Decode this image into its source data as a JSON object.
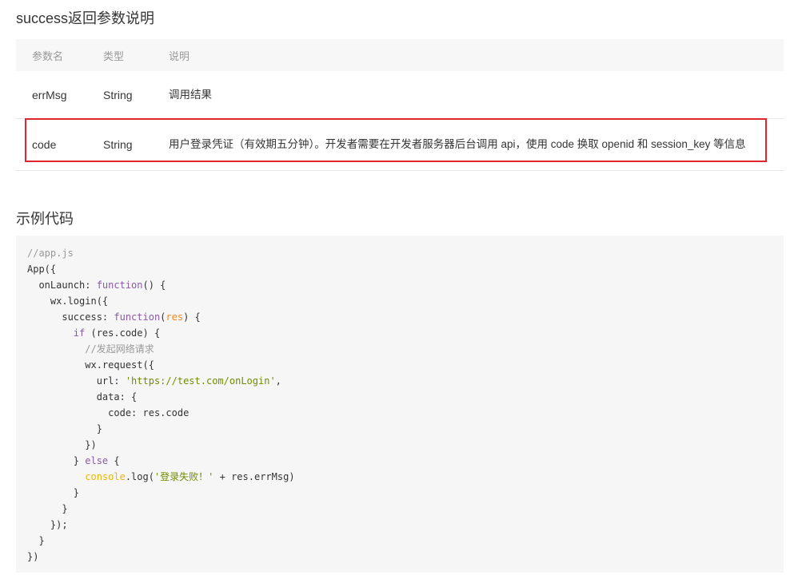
{
  "section_params": {
    "title": "success返回参数说明",
    "headers": [
      "参数名",
      "类型",
      "说明"
    ],
    "rows": [
      {
        "name": "errMsg",
        "type": "String",
        "desc": "调用结果"
      },
      {
        "name": "code",
        "type": "String",
        "desc": "用户登录凭证（有效期五分钟）。开发者需要在开发者服务器后台调用 api，使用 code 换取 openid 和 session_key 等信息"
      }
    ],
    "highlight_color": "#e0262b"
  },
  "section_example": {
    "title": "示例代码",
    "code_lines": [
      [
        {
          "t": "//app.js",
          "c": "comment"
        }
      ],
      [
        {
          "t": "App({"
        }
      ],
      [
        {
          "t": "  onLaunch: "
        },
        {
          "t": "function",
          "c": "key"
        },
        {
          "t": "() {"
        }
      ],
      [
        {
          "t": "    wx.login({"
        }
      ],
      [
        {
          "t": "      success: "
        },
        {
          "t": "function",
          "c": "key"
        },
        {
          "t": "("
        },
        {
          "t": "res",
          "c": "param"
        },
        {
          "t": ") {"
        }
      ],
      [
        {
          "t": "        "
        },
        {
          "t": "if",
          "c": "key"
        },
        {
          "t": " (res.code) {"
        }
      ],
      [
        {
          "t": "          "
        },
        {
          "t": "//发起网络请求",
          "c": "comment"
        }
      ],
      [
        {
          "t": "          wx.request({"
        }
      ],
      [
        {
          "t": "            url: "
        },
        {
          "t": "'https://test.com/onLogin'",
          "c": "string"
        },
        {
          "t": ","
        }
      ],
      [
        {
          "t": "            data: {"
        }
      ],
      [
        {
          "t": "              code: res.code"
        }
      ],
      [
        {
          "t": "            }"
        }
      ],
      [
        {
          "t": "          })"
        }
      ],
      [
        {
          "t": "        } "
        },
        {
          "t": "else",
          "c": "key"
        },
        {
          "t": " {"
        }
      ],
      [
        {
          "t": "          "
        },
        {
          "t": "console",
          "c": "builtin"
        },
        {
          "t": ".log("
        },
        {
          "t": "'登录失败！'",
          "c": "string"
        },
        {
          "t": " + res.errMsg)"
        }
      ],
      [
        {
          "t": "        }"
        }
      ],
      [
        {
          "t": "      }"
        }
      ],
      [
        {
          "t": "    });"
        }
      ],
      [
        {
          "t": "  }"
        }
      ],
      [
        {
          "t": "})"
        }
      ]
    ]
  }
}
